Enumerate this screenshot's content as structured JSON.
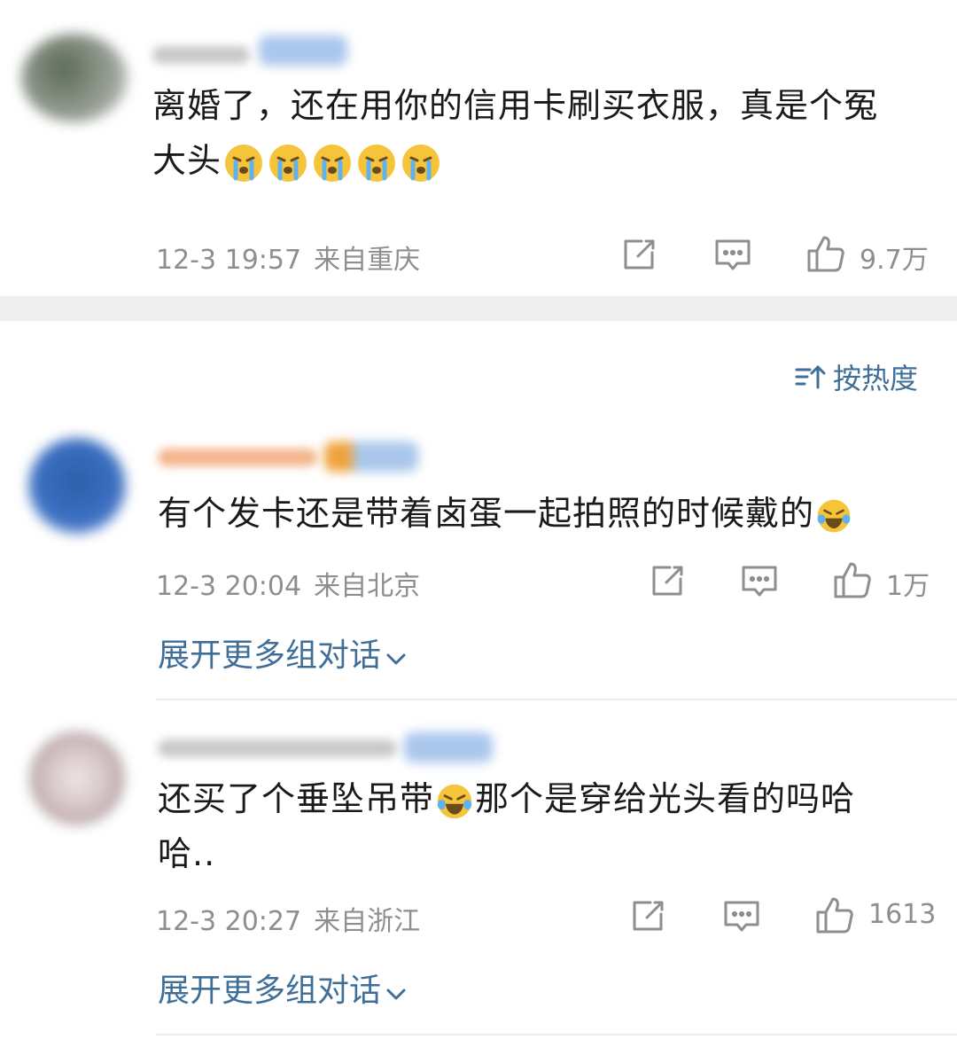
{
  "comments": [
    {
      "text_line1": "离婚了，还在用你的信用卡刷买衣服，真是个冤",
      "text_line2": "大头",
      "emoji_name": "crying-face-emoji",
      "time": "12-3 19:57",
      "location": "来自重庆",
      "likes": "9.7万"
    },
    {
      "text_line1": "有个发卡还是带着卤蛋一起拍照的时候戴的",
      "emoji_name": "laughing-tears-emoji",
      "time": "12-3 20:04",
      "location": "来自北京",
      "likes": "1万",
      "expand": "展开更多组对话"
    },
    {
      "text_line1a": "还买了个垂坠吊带",
      "text_line1b": "那个是穿给光头看的吗哈",
      "text_line2": "哈..",
      "emoji_name": "laughing-tears-emoji",
      "time": "12-3 20:27",
      "location": "来自浙江",
      "likes": "1613",
      "expand": "展开更多组对话"
    }
  ],
  "sort": {
    "label": "按热度",
    "icon": "sort-icon"
  },
  "icons": [
    "share-icon",
    "comment-icon",
    "like-icon",
    "chevron-down-icon"
  ],
  "colors": {
    "link": "#3f6f98",
    "meta": "#8e8e8e",
    "text": "#1a1a1a",
    "section_gap": "#eeeeee"
  }
}
